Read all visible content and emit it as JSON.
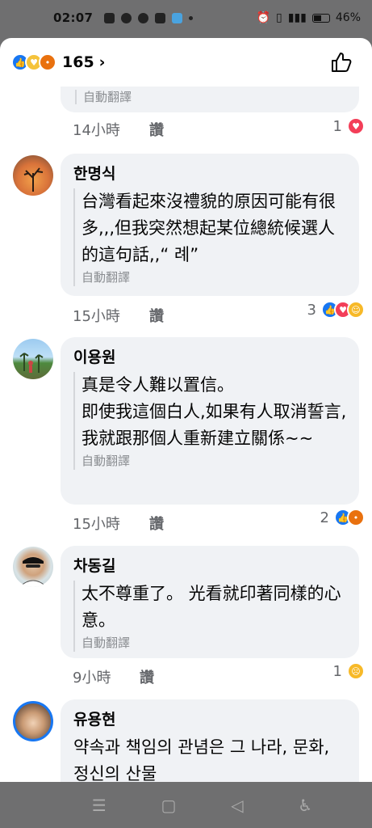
{
  "status": {
    "time": "02:07",
    "battery": "46%"
  },
  "reactions": {
    "total": "165"
  },
  "first": {
    "translate": "自動翻譯",
    "time": "14小時",
    "like": "讚",
    "rx_count": "1"
  },
  "comments": [
    {
      "name": "한명식",
      "text": "台灣看起來沒禮貌的原因可能有很多,,,但我突然想起某位總統候選人的這句話,,“ 례”",
      "translate": "自動翻譯",
      "time": "15小時",
      "like": "讚",
      "rx_count": "3"
    },
    {
      "name": "이용원",
      "text": "真是令人難以置信。\n即使我這個白人,如果有人取消誓言,我就跟那個人重新建立關係~~",
      "translate": "自動翻譯",
      "time": "15小時",
      "like": "讚",
      "rx_count": "2"
    },
    {
      "name": "차동길",
      "text": "太不尊重了。 光看就印著同樣的心意。",
      "translate": "自動翻譯",
      "time": "9小時",
      "like": "讚",
      "rx_count": "1"
    },
    {
      "name": "유용현",
      "text": "약속과 책임의 관념은 그 나라, 문화, 정신의 산물",
      "translate": "",
      "time": "",
      "like": "",
      "rx_count": ""
    }
  ]
}
